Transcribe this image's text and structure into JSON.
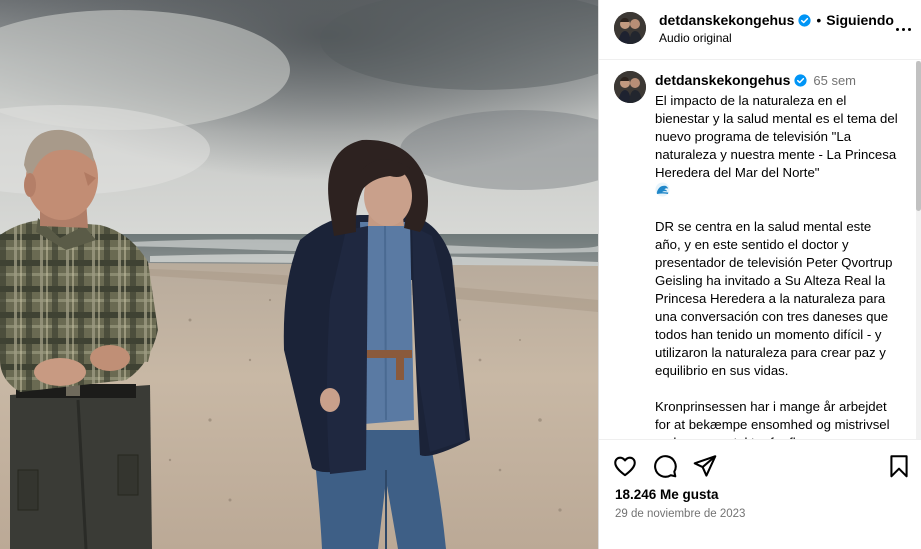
{
  "post": {
    "username": "detdanskekongehus",
    "separator": "•",
    "follow_status": "Siguiendo",
    "audio_label": "Audio original",
    "caption_time": "65 sem",
    "caption_paragraphs": [
      "El impacto de la naturaleza en el bienestar y la salud mental es el tema del nuevo programa de televisión \"La naturaleza y nuestra mente - La Princesa Heredera del Mar del Norte\"",
      "DR se centra en la salud mental este año, y en este sentido el doctor y presentador de televisión Peter Qvortrup Geisling ha invitado a Su Alteza Real la Princesa Heredera a la naturaleza para una conversación con tres daneses que todos han tenido un momento difícil - y utilizaron la naturaleza para crear paz y equilibrio en sus vidas.",
      "Kronprinsessen har i mange år arbejdet for at bekæmpe ensomhed og mistrivsel og hun er protektor for flere organisationer."
    ],
    "likes": "18.246 Me gusta",
    "date": "29 de noviembre de 2023"
  },
  "icons": {
    "verified": "verified-badge-icon",
    "wave": "water-wave-emoji",
    "like": "heart-icon",
    "comment": "comment-icon",
    "share": "paper-plane-icon",
    "save": "bookmark-icon",
    "more": "more-options-icon"
  },
  "colors": {
    "verified_blue": "#0095f6",
    "secondary_text": "#737373"
  }
}
